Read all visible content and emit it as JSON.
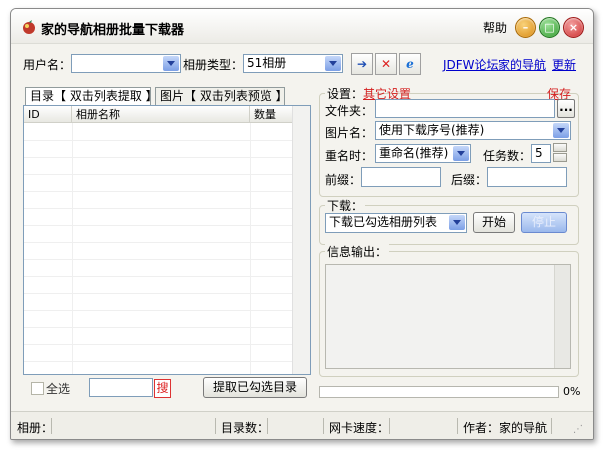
{
  "window": {
    "title": "家的导航相册批量下载器",
    "help_label": "帮助"
  },
  "toolbar": {
    "username_label": "用户名：",
    "username_value": "",
    "album_type_label": "相册类型：",
    "album_type_value": "51相册",
    "links": [
      "JDFW论坛",
      "家的导航",
      "更新"
    ]
  },
  "tabs": [
    "目录【 双击列表提取 】",
    "图片【 双击列表预览 】"
  ],
  "list": {
    "columns": [
      "ID",
      "相册名称",
      "数量"
    ]
  },
  "bottom": {
    "select_all_label": "全选",
    "search_label": "搜",
    "extract_label": "提取已勾选目录"
  },
  "settings": {
    "group_label": "设置：",
    "other_link": "其它设置",
    "save_link": "保存",
    "folder_label": "文件夹：",
    "folder_value": "",
    "browse_label": "...",
    "filename_label": "图片名：",
    "filename_value": "使用下载序号(推荐)",
    "rename_label": "重名时：",
    "rename_value": "重命名(推荐)",
    "tasks_label": "任务数：",
    "tasks_value": "5",
    "prefix_label": "前缀：",
    "suffix_label": "后缀："
  },
  "download": {
    "group_label": "下载：",
    "mode_value": "下载已勾选相册列表",
    "start_label": "开始",
    "stop_label": "停止"
  },
  "info": {
    "group_label": "信息输出："
  },
  "progress": {
    "value": 0,
    "label": "0%"
  },
  "status": {
    "album_label": "相册：",
    "dir_count_label": "目录数：",
    "speed_label": "网卡速度：",
    "author_label": "作者：家的导航"
  }
}
